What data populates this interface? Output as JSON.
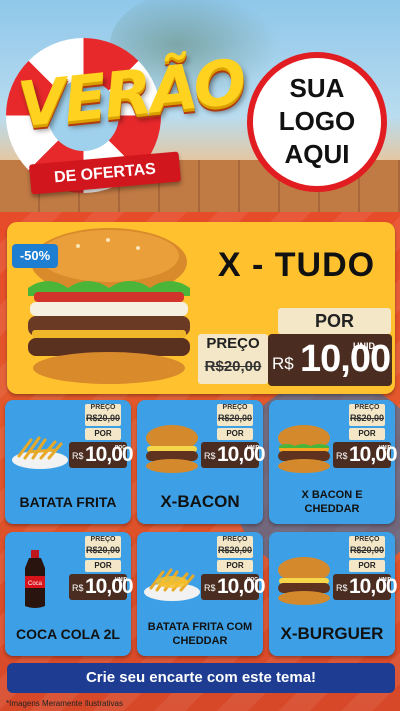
{
  "header": {
    "title_main": "VERÃO",
    "title_ribbon": "DE OFERTAS",
    "logo_line1": "SUA",
    "logo_line2": "LOGO",
    "logo_line3": "AQUI"
  },
  "featured": {
    "badge": "-50%",
    "name": "X - TUDO",
    "old_label": "PREÇO",
    "old_price": "R$20,00",
    "por_label": "POR",
    "currency": "R$",
    "price": "10,00",
    "unit": "UNID"
  },
  "products": [
    {
      "name": "BATATA FRITA",
      "old_label": "PREÇO",
      "old_price": "R$20,00",
      "por_label": "POR",
      "currency": "R$",
      "price": "10,00",
      "unit": "POÇ"
    },
    {
      "name": "X-BACON",
      "old_label": "PREÇO",
      "old_price": "R$20,00",
      "por_label": "POR",
      "currency": "R$",
      "price": "10,00",
      "unit": "UNID"
    },
    {
      "name": "X BACON E CHEDDAR",
      "old_label": "PREÇO",
      "old_price": "R$20,00",
      "por_label": "POR",
      "currency": "R$",
      "price": "10,00",
      "unit": "UNID"
    },
    {
      "name": "COCA COLA 2L",
      "old_label": "PREÇO",
      "old_price": "R$20,00",
      "por_label": "POR",
      "currency": "R$",
      "price": "10,00",
      "unit": "UNID"
    },
    {
      "name": "BATATA FRITA COM CHEDDAR",
      "old_label": "PREÇO",
      "old_price": "R$20,00",
      "por_label": "POR",
      "currency": "R$",
      "price": "10,00",
      "unit": "POÇ"
    },
    {
      "name": "X-BURGUER",
      "old_label": "PREÇO",
      "old_price": "R$20,00",
      "por_label": "POR",
      "currency": "R$",
      "price": "10,00",
      "unit": "UNID"
    }
  ],
  "cta": "Crie seu encarte com este tema!",
  "disclaimer": "*Imagens Meramente Ilustrativas"
}
